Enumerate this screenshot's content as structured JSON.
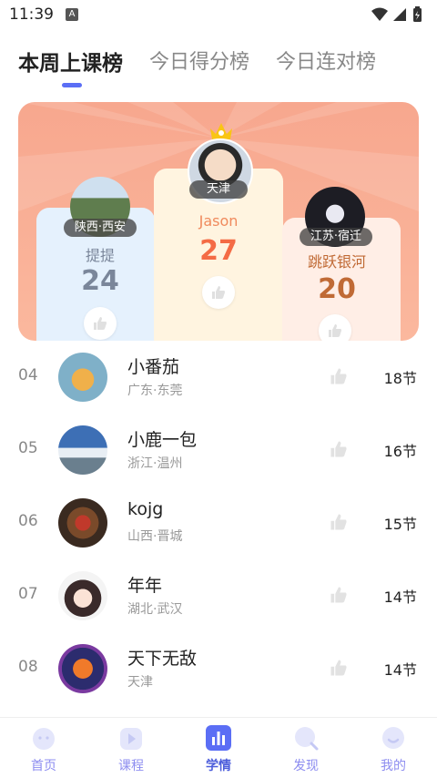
{
  "status_bar": {
    "time": "11:39",
    "notif_letter": "A"
  },
  "tabs": [
    {
      "label": "本周上课榜",
      "active": true
    },
    {
      "label": "今日得分榜",
      "active": false
    },
    {
      "label": "今日连对榜",
      "active": false
    }
  ],
  "podium": {
    "first": {
      "name": "Jason",
      "location": "天津",
      "score": "27"
    },
    "second": {
      "name": "提提",
      "location": "陕西·西安",
      "score": "24"
    },
    "third": {
      "name": "跳跃银河",
      "location": "江苏·宿迁",
      "score": "20"
    }
  },
  "ranking": [
    {
      "rank": "04",
      "name": "小番茄",
      "location": "广东·东莞",
      "count": "18节"
    },
    {
      "rank": "05",
      "name": "小鹿一包",
      "location": "浙江·温州",
      "count": "16节"
    },
    {
      "rank": "06",
      "name": "kojg",
      "location": "山西·晋城",
      "count": "15节"
    },
    {
      "rank": "07",
      "name": "年年",
      "location": "湖北·武汉",
      "count": "14节"
    },
    {
      "rank": "08",
      "name": "天下无敌",
      "location": "天津",
      "count": "14节"
    }
  ],
  "bottom_nav": [
    {
      "label": "首页",
      "icon": "home-icon"
    },
    {
      "label": "课程",
      "icon": "course-icon"
    },
    {
      "label": "学情",
      "icon": "stats-icon",
      "active": true
    },
    {
      "label": "发现",
      "icon": "discover-icon"
    },
    {
      "label": "我的",
      "icon": "profile-icon"
    }
  ],
  "colors": {
    "accent": "#5b6ef5",
    "first_name": "#f08a5d",
    "first_score": "#f46b45",
    "second": "#7a869a",
    "third": "#c06a35"
  }
}
